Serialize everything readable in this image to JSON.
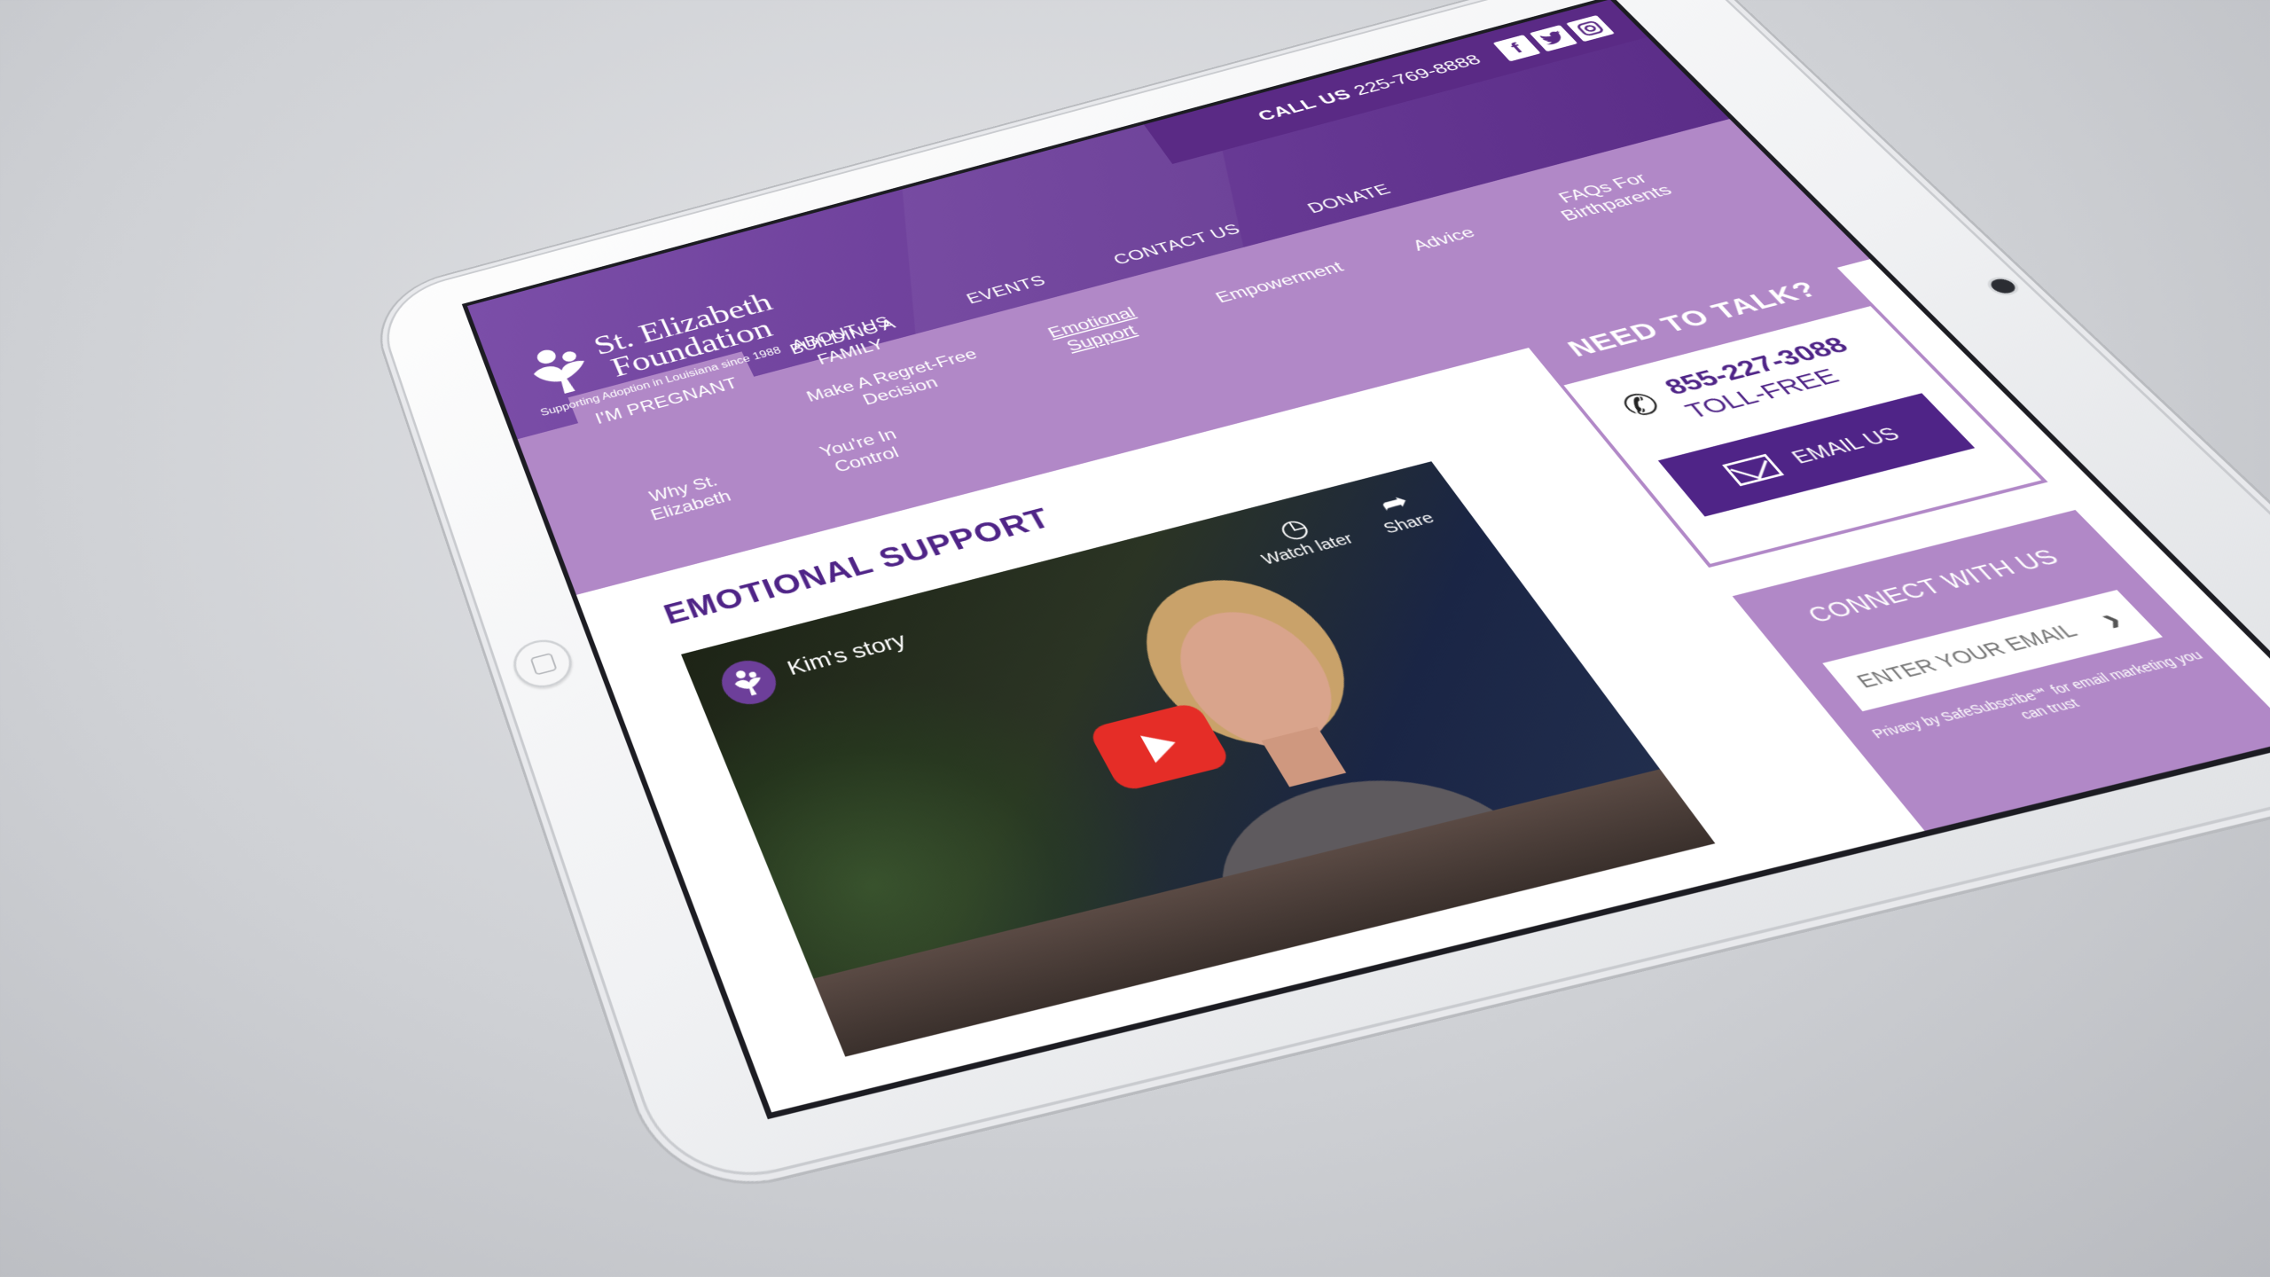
{
  "topbar": {
    "call_label": "CALL US",
    "phone": "225-769-8888",
    "social": [
      {
        "name": "facebook-icon",
        "glyph": "f"
      },
      {
        "name": "twitter-icon",
        "glyph": "t"
      },
      {
        "name": "instagram-icon",
        "glyph": "◎"
      }
    ]
  },
  "logo": {
    "name_line1": "St. Elizabeth",
    "name_line2": "Foundation",
    "tagline": "Supporting Adoption in Louisiana since 1988"
  },
  "mainnav": {
    "items": [
      {
        "label": "ABOUT US"
      },
      {
        "label": "EVENTS"
      },
      {
        "label": "CONTACT US"
      },
      {
        "label": "DONATE"
      }
    ],
    "building": "BUILDING A FAMILY",
    "active_tab": "I'M PREGNANT"
  },
  "subnav": {
    "row1": [
      {
        "label": "Make A Regret-Free Decision"
      },
      {
        "label": "Emotional Support",
        "current": true
      },
      {
        "label": "Empowerment"
      },
      {
        "label": "Advice"
      },
      {
        "label": "FAQs For Birthparents"
      }
    ],
    "row2": [
      {
        "label": "Why St. Elizabeth"
      },
      {
        "label": "You're In Control"
      }
    ]
  },
  "content": {
    "title": "EMOTIONAL SUPPORT",
    "video": {
      "title": "Kim's story",
      "watch_later": "Watch later",
      "share": "Share"
    }
  },
  "sidebar": {
    "talk_title": "NEED TO TALK?",
    "talk_phone": "855-227-3088",
    "talk_tollfree": "TOLL-FREE",
    "email_label": "EMAIL US",
    "connect_title": "CONNECT WITH US",
    "connect_placeholder": "ENTER YOUR EMAIL",
    "privacy": "Privacy by SafeSubscribe℠ for email marketing you can trust"
  },
  "colors": {
    "brand_purple": "#6d3f9a",
    "deep_purple": "#4f2487",
    "light_purple": "#b188c7",
    "youtube_red": "#e52d27"
  }
}
